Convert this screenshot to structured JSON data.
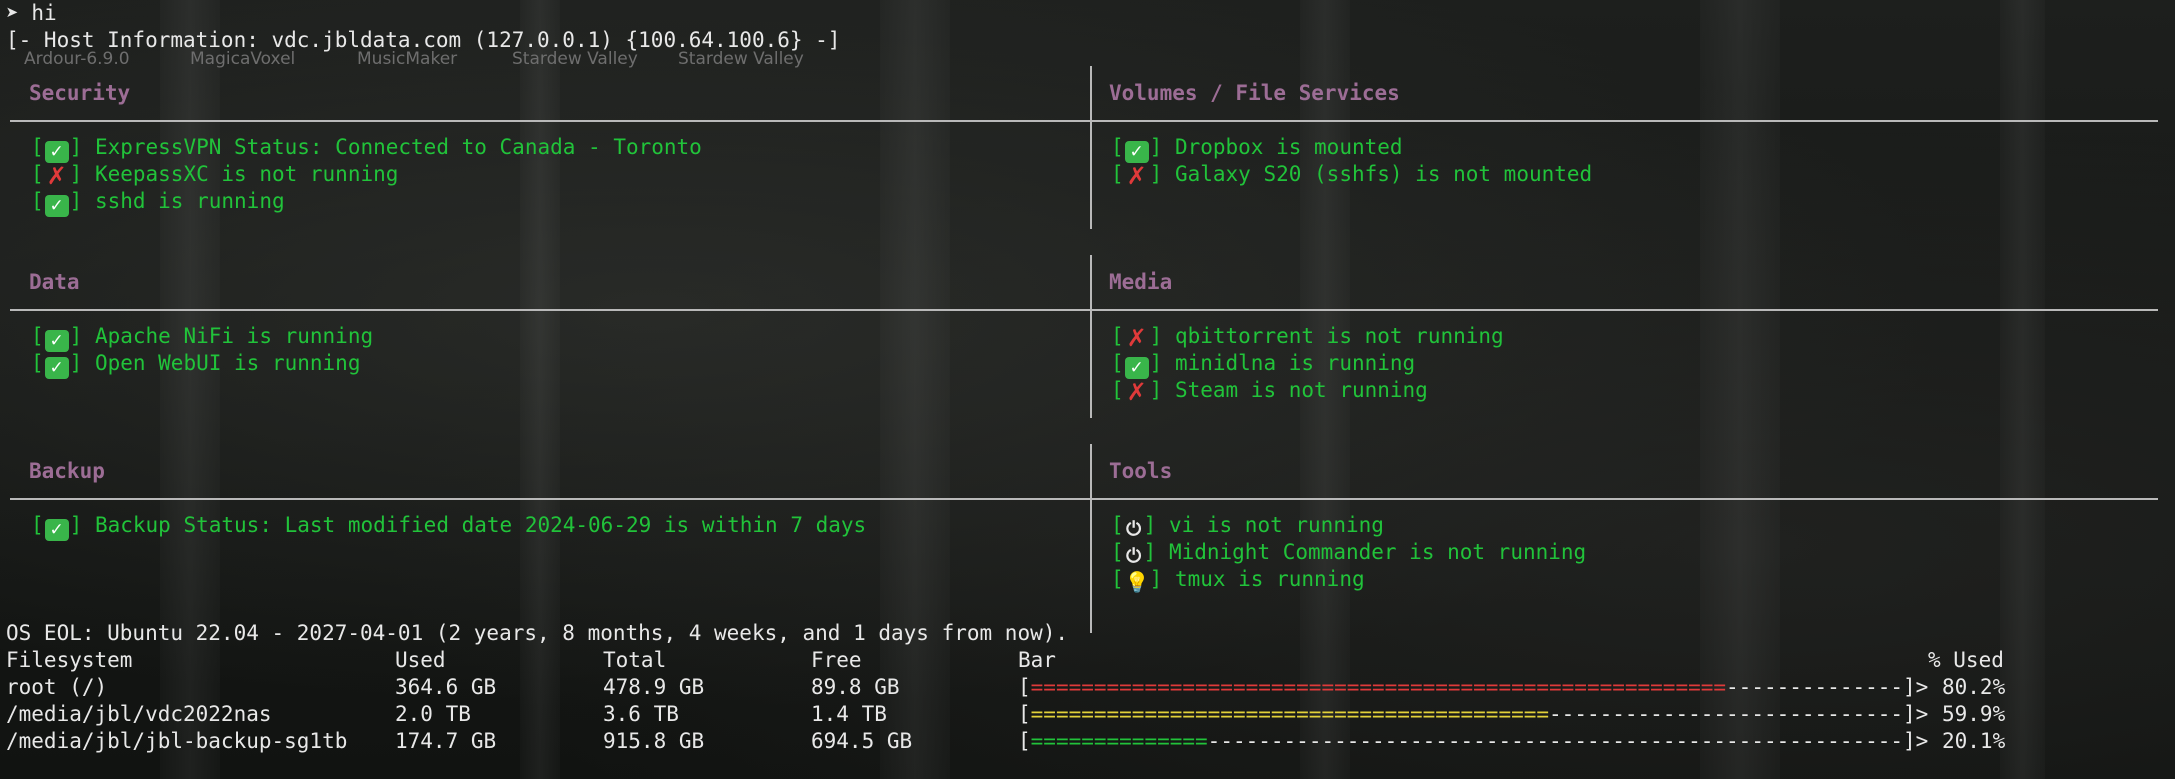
{
  "desktop_icons": [
    {
      "label": "Ardour-6.9.0"
    },
    {
      "label": "MagicaVoxel"
    },
    {
      "label": "MusicMaker"
    },
    {
      "label": "Stardew Valley"
    },
    {
      "label": "Stardew Valley"
    }
  ],
  "terminal": {
    "prompt_symbol": "➤",
    "command": "hi",
    "host_line": "[- Host Information: vdc.jbldata.com (127.0.0.1) {100.64.100.6} -]"
  },
  "sections": [
    {
      "title": "Security",
      "items": [
        {
          "status": "ok",
          "icon": "check-icon",
          "text": "ExpressVPN Status: Connected to Canada - Toronto"
        },
        {
          "status": "fail",
          "icon": "cross-icon",
          "text": "KeepassXC is not running"
        },
        {
          "status": "ok",
          "icon": "check-icon",
          "text": "sshd is running"
        }
      ]
    },
    {
      "title": "Volumes / File Services",
      "items": [
        {
          "status": "ok",
          "icon": "check-icon",
          "text": "Dropbox is mounted"
        },
        {
          "status": "fail",
          "icon": "cross-icon",
          "text": "Galaxy S20 (sshfs) is not mounted"
        }
      ]
    },
    {
      "title": "Data",
      "items": [
        {
          "status": "ok",
          "icon": "check-icon",
          "text": "Apache NiFi is running"
        },
        {
          "status": "ok",
          "icon": "check-icon",
          "text": "Open WebUI is running"
        }
      ]
    },
    {
      "title": "Media",
      "items": [
        {
          "status": "fail",
          "icon": "cross-icon",
          "text": "qbittorrent is not running"
        },
        {
          "status": "ok",
          "icon": "check-icon",
          "text": "minidlna is running"
        },
        {
          "status": "fail",
          "icon": "cross-icon",
          "text": "Steam is not running"
        }
      ]
    },
    {
      "title": "Backup",
      "items": [
        {
          "status": "ok",
          "icon": "check-icon",
          "text": "Backup Status: Last modified date 2024-06-29 is within 7 days"
        }
      ]
    },
    {
      "title": "Tools",
      "items": [
        {
          "status": "off",
          "icon": "power-icon",
          "text": "vi is not running"
        },
        {
          "status": "off",
          "icon": "power-icon",
          "text": "Midnight Commander is not running"
        },
        {
          "status": "on",
          "icon": "bulb-icon",
          "text": "tmux is running"
        }
      ]
    }
  ],
  "os_eol": "OS EOL: Ubuntu 22.04 - 2027-04-01 (2 years, 8 months, 4 weeks, and 1 days from now).",
  "filesystem_table": {
    "headers": {
      "filesystem": "Filesystem",
      "used": "Used",
      "total": "Total",
      "free": "Free",
      "bar": "Bar",
      "pct": "% Used"
    },
    "rows": [
      {
        "filesystem": "root (/)",
        "used": "364.6 GB",
        "total": "478.9 GB",
        "free": "89.8 GB",
        "pct": "80.2%",
        "fill_fraction": 0.802,
        "bar_color": "red"
      },
      {
        "filesystem": "/media/jbl/vdc2022nas",
        "used": "2.0 TB",
        "total": "3.6 TB",
        "free": "1.4 TB",
        "pct": "59.9%",
        "fill_fraction": 0.599,
        "bar_color": "yellow"
      },
      {
        "filesystem": "/media/jbl/jbl-backup-sg1tb",
        "used": "174.7 GB",
        "total": "915.8 GB",
        "free": "694.5 GB",
        "pct": "20.1%",
        "fill_fraction": 0.201,
        "bar_color": "green"
      }
    ]
  },
  "colors": {
    "section_title": "#9c6d95",
    "status_text": "#21c33a",
    "bar_red": "#e03a3a",
    "bar_yellow": "#e3d23a",
    "bar_green": "#21c33a",
    "background": "#141614"
  }
}
